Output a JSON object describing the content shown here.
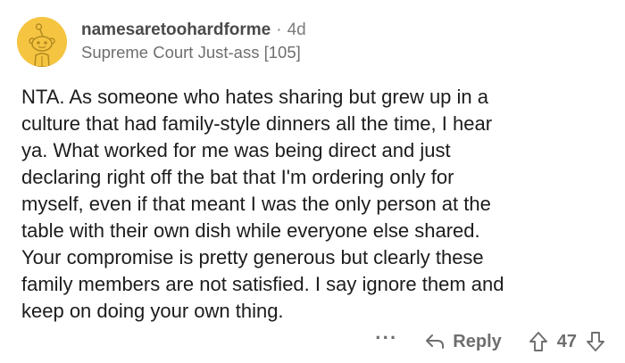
{
  "comment": {
    "username": "namesaretoohardforme",
    "separator": "·",
    "age": "4d",
    "flair": "Supreme Court Just-ass [105]",
    "body_lines": [
      "NTA. As someone who hates sharing but grew up in a",
      "culture that had family-style dinners all the time, I hear",
      "ya. What worked for me was being direct and just",
      "declaring right off the bat that I'm ordering only for",
      "myself, even if that meant I was the only person at the",
      "table with their own dish while everyone else shared.",
      "Your compromise is pretty generous but clearly these",
      "family members are not satisfied. I say ignore them and",
      "keep on doing your own thing."
    ],
    "actions": {
      "more_label": "···",
      "reply_label": "Reply",
      "vote_count": "47"
    },
    "icons": {
      "avatar": "snoo-avatar-icon",
      "reply": "reply-arrow-icon",
      "upvote": "upvote-arrow-icon",
      "downvote": "downvote-arrow-icon"
    },
    "colors": {
      "avatar_bg": "#f5c542",
      "text": "#1c1c1c",
      "muted": "#6e6e6e"
    }
  }
}
